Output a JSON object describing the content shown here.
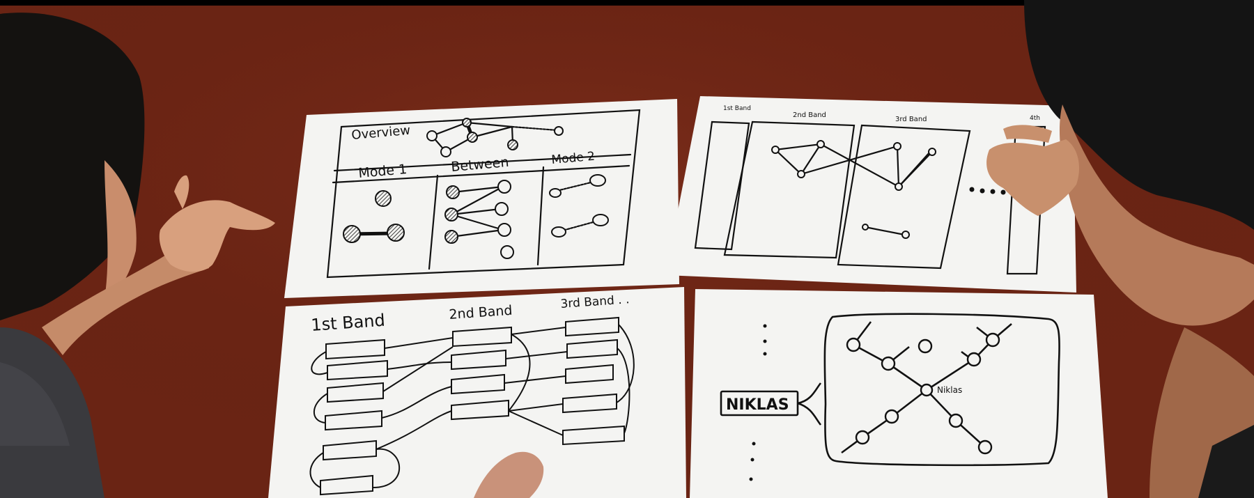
{
  "sketch_overview": {
    "title": "Overview",
    "col1": "Mode 1",
    "col2": "Between",
    "col3": "Mode 2"
  },
  "sketch_bands_top": {
    "band1": "1st Band",
    "band2": "2nd Band",
    "band3": "3rd Band",
    "band4": "4th"
  },
  "sketch_bands_bottom": {
    "band1": "1st Band",
    "band2": "2nd Band",
    "band3": "3rd Band . ."
  },
  "sketch_detail": {
    "label_box": "NIKLAS",
    "node_label": "Niklas"
  },
  "colors": {
    "table": "#6a2414",
    "paper": "#f4f4f2",
    "ink": "#111111",
    "hair": "#141414",
    "skin": "#d8a07e"
  }
}
